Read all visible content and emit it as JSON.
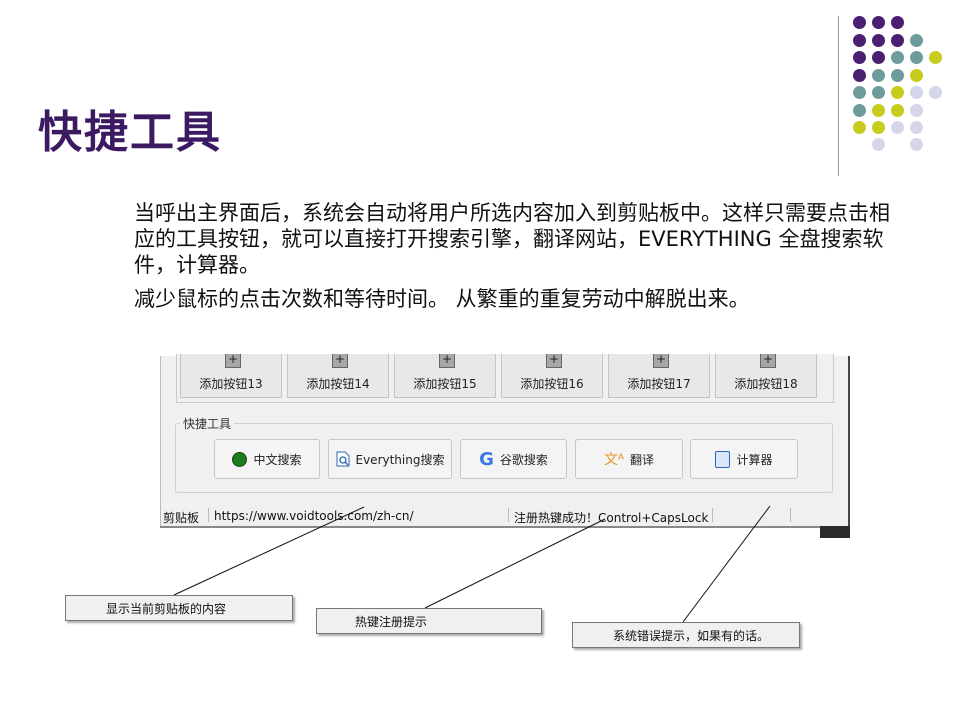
{
  "slide": {
    "title": "快捷工具",
    "paragraphs": [
      "当呼出主界面后，系统会自动将用户所选内容加入到剪贴板中。这样只需要点击相应的工具按钮，就可以直接打开搜索引擎，翻译网站，EVERYTHING 全盘搜索软件，计算器。",
      "减少鼠标的点击次数和等待时间。 从繁重的重复劳动中解脱出来。"
    ],
    "colors": {
      "title": "#3c1a62",
      "dot_purple": "#4b1f72",
      "dot_teal": "#6e9c9c",
      "dot_lime": "#c8cc1f",
      "dot_lavender": "#d6d6ea"
    }
  },
  "app": {
    "add_buttons": [
      {
        "plus": "+",
        "label": "添加按钮13"
      },
      {
        "plus": "+",
        "label": "添加按钮14"
      },
      {
        "plus": "+",
        "label": "添加按钮15"
      },
      {
        "plus": "+",
        "label": "添加按钮16"
      },
      {
        "plus": "+",
        "label": "添加按钮17"
      },
      {
        "plus": "+",
        "label": "添加按钮18"
      }
    ],
    "group_label": "快捷工具",
    "tools": [
      {
        "icon": "green-circle-icon",
        "label": "中文搜索"
      },
      {
        "icon": "file-search-icon",
        "label": "Everything搜索"
      },
      {
        "icon": "google-g-icon",
        "label": "谷歌搜索"
      },
      {
        "icon": "translate-icon",
        "label": "翻译"
      },
      {
        "icon": "calculator-icon",
        "label": "计算器"
      }
    ],
    "status": {
      "clipboard_label": "剪贴板",
      "clipboard_content": "https://www.voidtools.com/zh-cn/",
      "hotkey_message": "注册热键成功！Control+CapsLock"
    }
  },
  "callouts": {
    "clipboard": "显示当前剪贴板的内容",
    "hotkey": "热键注册提示",
    "error": "系统错误提示，如果有的话。"
  }
}
